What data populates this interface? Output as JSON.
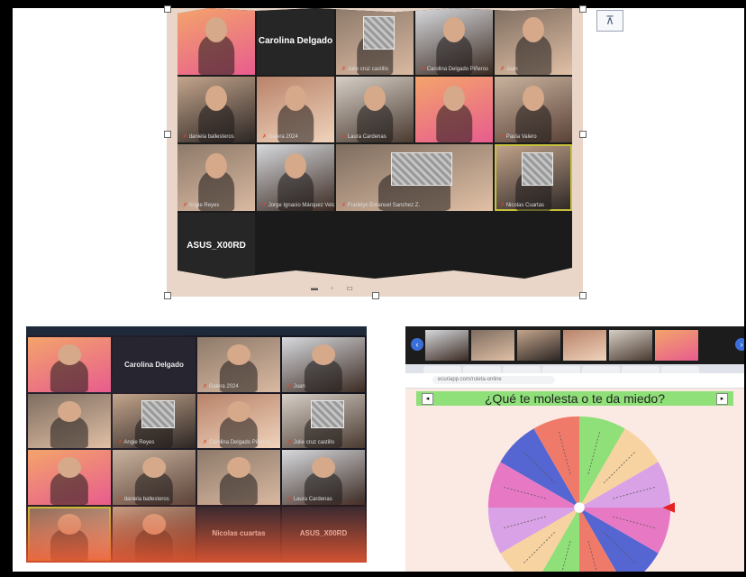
{
  "top_image": {
    "tiles": [
      {
        "kind": "video",
        "label": ""
      },
      {
        "kind": "name",
        "name": "Carolina Delgado"
      },
      {
        "kind": "video",
        "label": "Julie cruz castillo"
      },
      {
        "kind": "video",
        "label": "Carolina Delgado Piñeros"
      },
      {
        "kind": "video",
        "label": "Juan"
      },
      {
        "kind": "video",
        "label": "daniela ballesteros"
      },
      {
        "kind": "video",
        "label": "Galera 2024"
      },
      {
        "kind": "video",
        "label": "Laura Cardenas"
      },
      {
        "kind": "video",
        "label": ""
      },
      {
        "kind": "video",
        "label": "Paula Valero"
      },
      {
        "kind": "video",
        "label": "Angie Reyes"
      },
      {
        "kind": "video",
        "label": "Jorge Ignacio Márquez Vela"
      },
      {
        "kind": "video",
        "label": "Franklyn Emanuel Sanchez Z."
      },
      {
        "kind": "video",
        "label": "Nicolas Cuartas"
      },
      {
        "kind": "name",
        "name": "ASUS_X00RD"
      }
    ]
  },
  "bottom_left": {
    "tiles": [
      {
        "kind": "video",
        "label": ""
      },
      {
        "kind": "name",
        "name": "Carolina Delgado"
      },
      {
        "kind": "video",
        "label": "Galera 2024"
      },
      {
        "kind": "video",
        "label": "Juan"
      },
      {
        "kind": "video",
        "label": ""
      },
      {
        "kind": "video",
        "label": "Angie Reyes"
      },
      {
        "kind": "video",
        "label": "Carolina Delgado Piñeros"
      },
      {
        "kind": "video",
        "label": "Julie cruz castillo"
      },
      {
        "kind": "video",
        "label": ""
      },
      {
        "kind": "video",
        "label": "daniela ballesteros"
      },
      {
        "kind": "video",
        "label": ""
      },
      {
        "kind": "video",
        "label": "Laura Cardenas"
      },
      {
        "kind": "video",
        "label": ""
      },
      {
        "kind": "video",
        "label": ""
      },
      {
        "kind": "name",
        "name": "Nicolas cuartas"
      },
      {
        "kind": "name",
        "name": "ASUS_X00RD"
      }
    ]
  },
  "bottom_right": {
    "question": "¿Qué te molesta o te da miedo?",
    "url": "ecuriapp.com/ruleta-online",
    "wheel_colors": [
      "#8fe079",
      "#f6d3a0",
      "#d9a2e6",
      "#e779c4",
      "#5565d1",
      "#f07a6a",
      "#8fe079",
      "#f6d3a0",
      "#d9a2e6",
      "#e779c4",
      "#5565d1",
      "#f07a6a"
    ]
  }
}
